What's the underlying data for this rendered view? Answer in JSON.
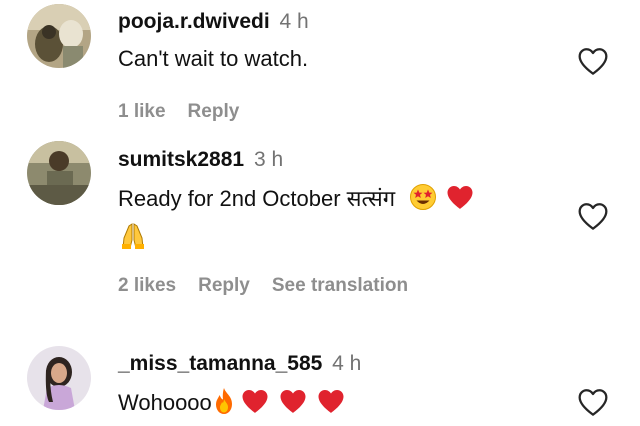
{
  "comments": [
    {
      "username": "pooja.r.dwivedi",
      "time": "4 h",
      "text": "Can't wait to watch.",
      "likes": "1 like",
      "reply": "Reply"
    },
    {
      "username": "sumitsk2881",
      "time": "3 h",
      "text": "Ready for 2nd October सत्संग",
      "likes": "2 likes",
      "reply": "Reply",
      "translate": "See translation"
    },
    {
      "username": "_miss_tamanna_585",
      "time": "4 h",
      "text": "Wohoooo"
    }
  ],
  "icons": {
    "like": "heart-outline-icon",
    "star_eyes": "star-struck-emoji",
    "red_heart": "red-heart-emoji",
    "praying": "praying-hands-emoji",
    "fire": "fire-emoji"
  },
  "colors": {
    "text": "#111111",
    "muted": "#737373",
    "action": "#8e8e8e",
    "heart_red": "#e0232e"
  }
}
